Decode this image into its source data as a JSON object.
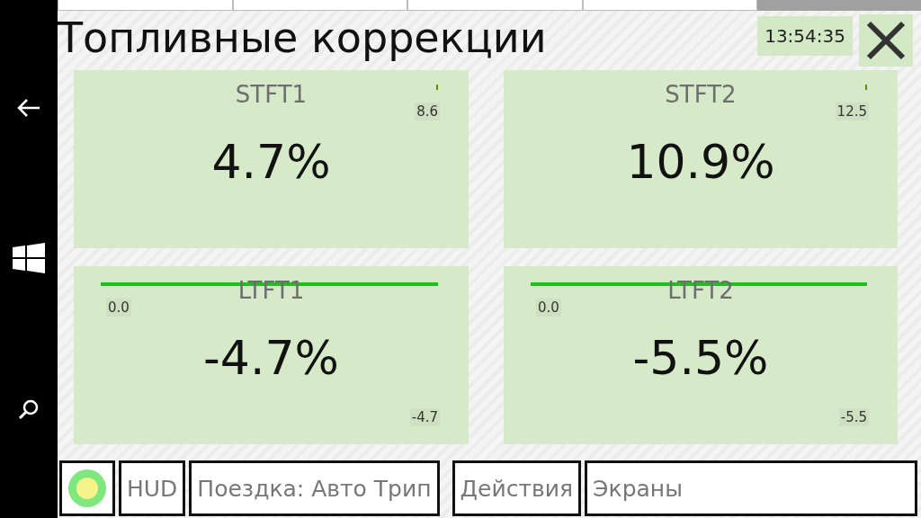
{
  "title": "Топливные коррекции",
  "clock": "13:54:35",
  "gauges": [
    {
      "label": "STFT1",
      "value": "4.7%",
      "kind": "tick",
      "mark": "8.6"
    },
    {
      "label": "STFT2",
      "value": "10.9%",
      "kind": "tick",
      "mark": "12.5"
    },
    {
      "label": "LTFT1",
      "value": "-4.7%",
      "kind": "line",
      "start": "0.0",
      "mark": "-4.7"
    },
    {
      "label": "LTFT2",
      "value": "-5.5%",
      "kind": "line",
      "start": "0.0",
      "mark": "-5.5"
    }
  ],
  "bottom_bar": [
    {
      "kind": "status"
    },
    {
      "kind": "button",
      "label": "HUD"
    },
    {
      "kind": "button",
      "label": "Поездка: Авто Трип"
    },
    {
      "kind": "button",
      "label": "Действия"
    },
    {
      "kind": "button",
      "label": "Экраны"
    }
  ]
}
